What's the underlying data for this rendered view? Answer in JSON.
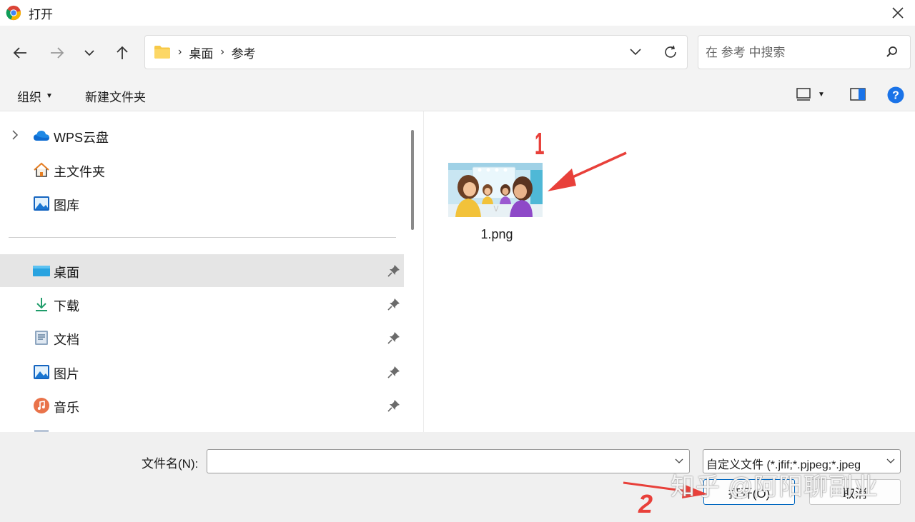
{
  "window": {
    "title": "打开",
    "app_icon": "chrome-icon",
    "close_icon": "close-icon"
  },
  "nav": {
    "back_icon": "arrow-left-icon",
    "forward_icon": "arrow-right-icon",
    "recent_icon": "chevron-down-icon",
    "up_icon": "arrow-up-icon",
    "breadcrumb": [
      "桌面",
      "参考"
    ],
    "search_placeholder": "在 参考 中搜索"
  },
  "commands": {
    "organize": "组织",
    "new_folder": "新建文件夹"
  },
  "sidebar": {
    "items": [
      {
        "label": "WPS云盘",
        "icon": "cloud-icon",
        "expandable": true,
        "pinned": false
      },
      {
        "label": "主文件夹",
        "icon": "home-icon",
        "expandable": false,
        "pinned": false
      },
      {
        "label": "图库",
        "icon": "gallery-icon",
        "expandable": false,
        "pinned": false
      },
      {
        "label": "桌面",
        "icon": "desktop-icon",
        "pinned": true,
        "selected": true
      },
      {
        "label": "下载",
        "icon": "download-icon",
        "pinned": true
      },
      {
        "label": "文档",
        "icon": "document-icon",
        "pinned": true
      },
      {
        "label": "图片",
        "icon": "pictures-icon",
        "pinned": true
      },
      {
        "label": "音乐",
        "icon": "music-icon",
        "pinned": true
      }
    ]
  },
  "files": [
    {
      "name": "1.png",
      "icon": "image-thumbnail"
    }
  ],
  "footer": {
    "filename_label": "文件名(N):",
    "filename_value": "",
    "filter_value": "自定义文件 (*.jfif;*.pjpeg;*.jpeg",
    "open_button": "打开(O)",
    "cancel_button": "取消"
  },
  "annotations": {
    "step1": "1",
    "step2": "2",
    "color": "#e8403a"
  },
  "watermark": "知乎 @阿阳聊副业",
  "colors": {
    "accent": "#0067c0",
    "selected_bg": "#e5e5e5",
    "help": "#1a73e8"
  }
}
